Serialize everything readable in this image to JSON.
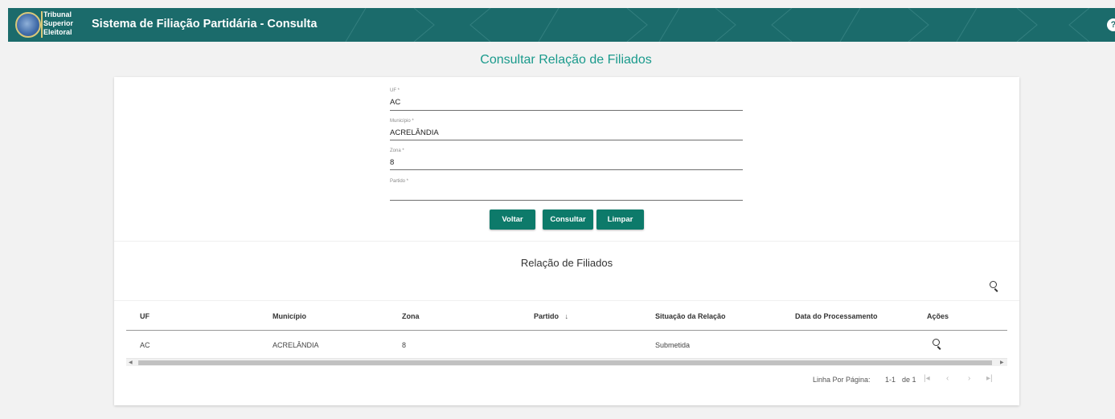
{
  "header": {
    "logo_lines": [
      "Tribunal",
      "Superior",
      "Eleitoral"
    ],
    "app_title": "Sistema de Filiação Partidária - Consulta",
    "help_symbol": "?"
  },
  "page_title": "Consultar Relação de Filiados",
  "form": {
    "uf": {
      "label": "UF *",
      "value": "AC"
    },
    "municipio": {
      "label": "Município *",
      "value": "ACRELÂNDIA"
    },
    "zona": {
      "label": "Zona *",
      "value": "8"
    },
    "partido": {
      "label": "Partido *",
      "value": ""
    },
    "buttons": {
      "voltar": "Voltar",
      "consultar": "Consultar",
      "limpar": "Limpar"
    }
  },
  "results": {
    "title": "Relação de Filiados",
    "columns": [
      "UF",
      "Município",
      "Zona",
      "Partido",
      "Situação da Relação",
      "Data do Processamento",
      "Ações"
    ],
    "sort_indicator": "↓",
    "rows": [
      {
        "uf": "AC",
        "municipio": "ACRELÂNDIA",
        "zona": "8",
        "partido": "",
        "situacao": "Submetida",
        "data": ""
      }
    ],
    "pagination": {
      "rows_per_page_label": "Linha Por Página:",
      "range": "1-1",
      "of_label": "de 1"
    }
  },
  "colors": {
    "header_bg": "#1b6b6b",
    "title_teal": "#1a9a8c",
    "button_bg": "#0d7a6a"
  }
}
